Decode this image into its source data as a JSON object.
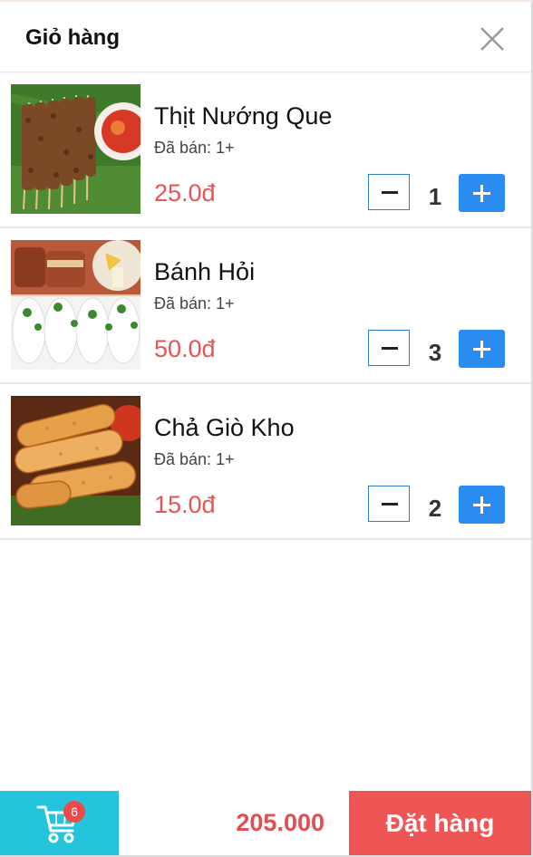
{
  "header": {
    "title": "Giỏ hàng",
    "close_icon": "close-icon"
  },
  "items": [
    {
      "name": "Thịt Nướng Que",
      "sold": "Đã bán: 1+",
      "price": "25.0đ",
      "quantity": "1"
    },
    {
      "name": "Bánh Hỏi",
      "sold": "Đã bán: 1+",
      "price": "50.0đ",
      "quantity": "3"
    },
    {
      "name": "Chả Giò Kho",
      "sold": "Đã bán: 1+",
      "price": "15.0đ",
      "quantity": "2"
    }
  ],
  "footer": {
    "cart_icon": "cart-icon",
    "cart_count": "6",
    "total": "205.000",
    "order_label": "Đặt hàng"
  },
  "colors": {
    "cart_button": "#24c4dc",
    "order_button": "#ee5555",
    "price": "#e85454",
    "plus_button": "#2a8cf0"
  }
}
